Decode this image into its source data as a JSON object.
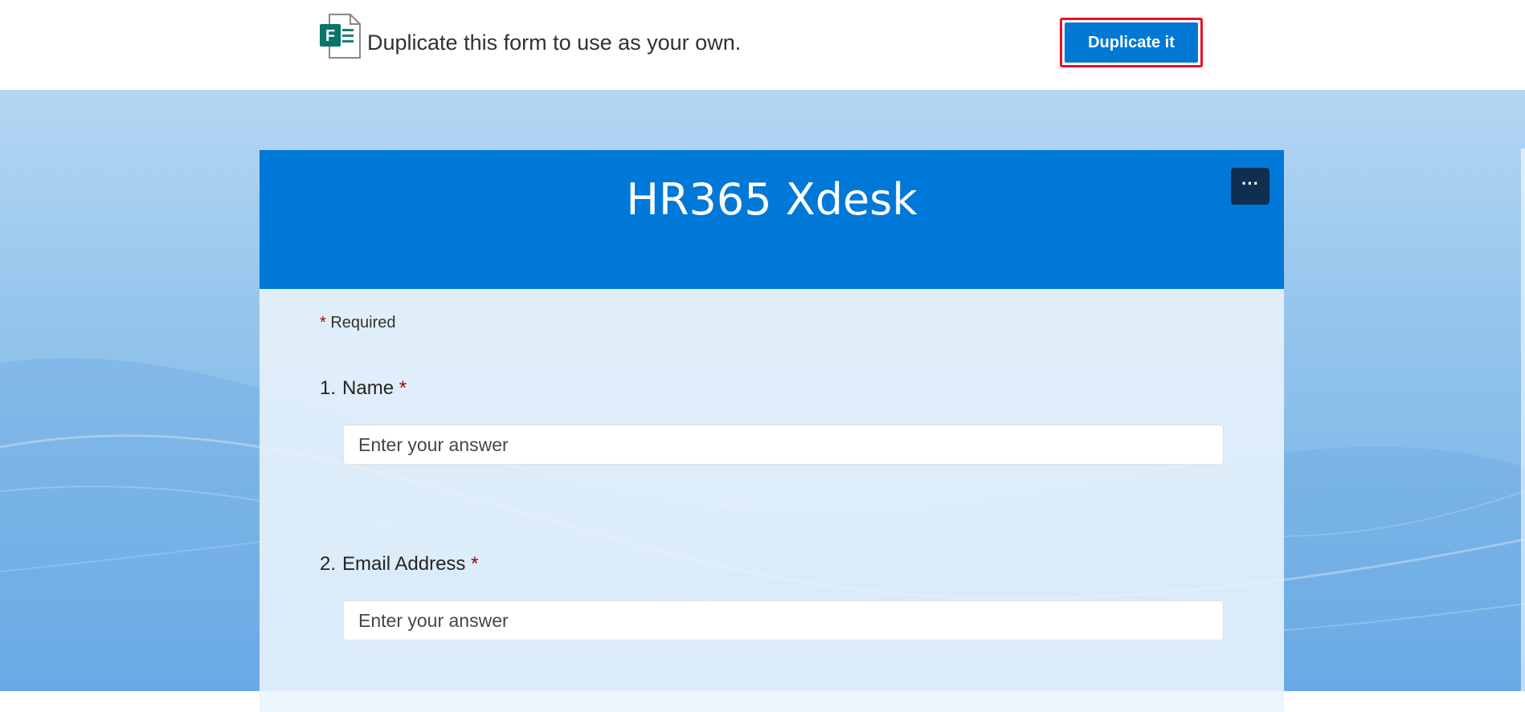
{
  "banner": {
    "text": "Duplicate this form to use as your own.",
    "button_label": "Duplicate it",
    "logo_letter": "F",
    "logo_icon": "microsoft-forms-icon"
  },
  "form": {
    "title": "HR365 Xdesk",
    "more_label": "···",
    "required_star": "*",
    "required_text": "Required",
    "questions": [
      {
        "number": "1.",
        "label": "Name",
        "star": "*",
        "placeholder": "Enter your answer"
      },
      {
        "number": "2.",
        "label": "Email Address",
        "star": "*",
        "placeholder": "Enter your answer"
      }
    ]
  },
  "colors": {
    "accent": "#0078d4",
    "header": "#0078d7",
    "highlight": "#e81123",
    "required": "#a80000"
  }
}
